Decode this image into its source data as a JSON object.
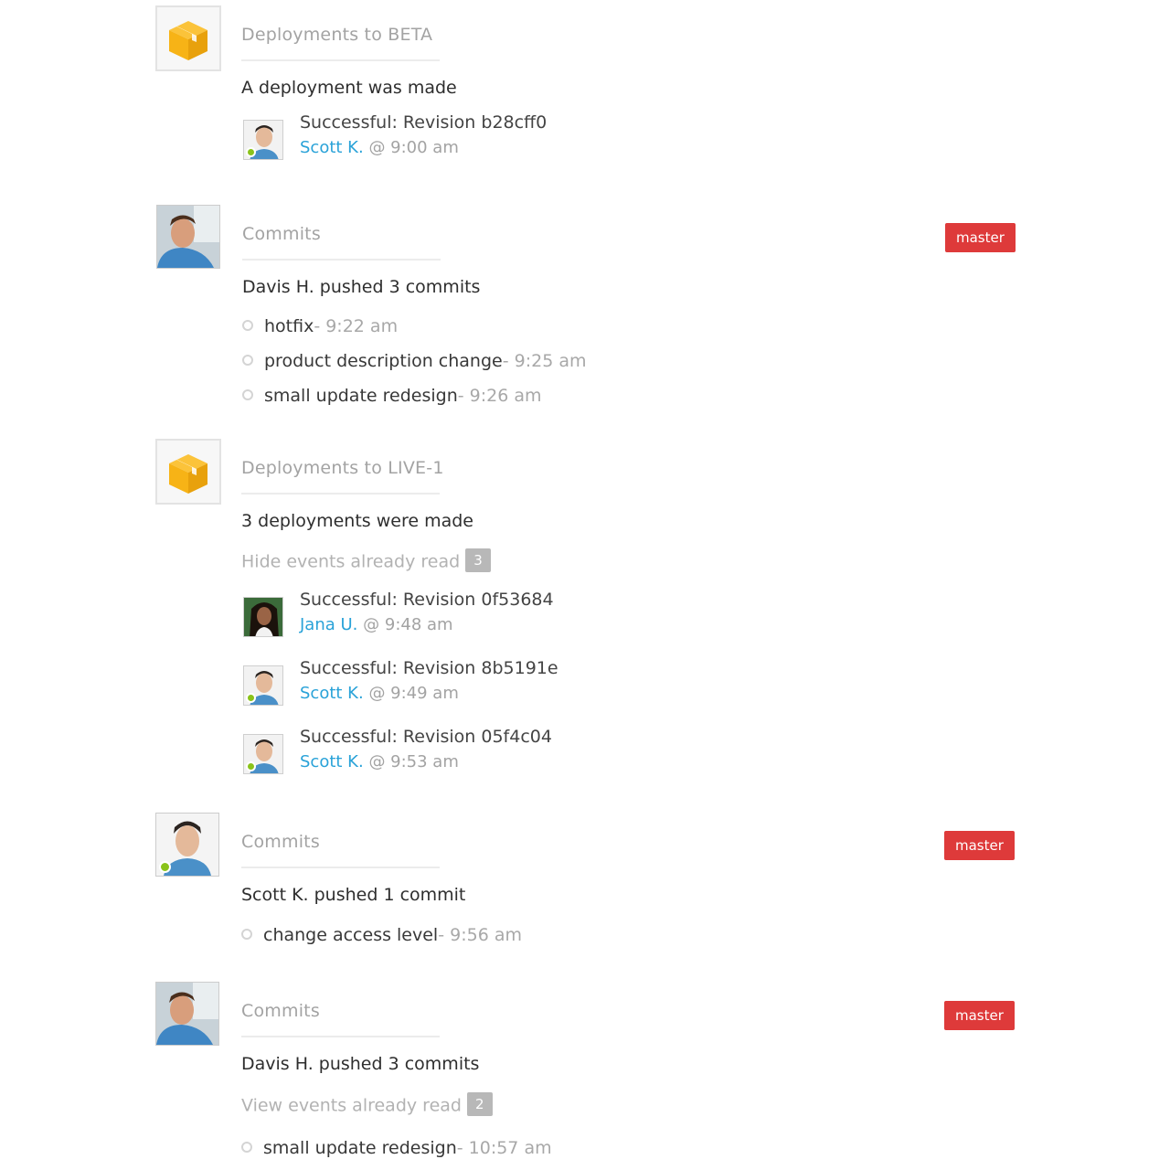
{
  "colors": {
    "accent": "#29a2d8",
    "badge": "#de3a3a",
    "online": "#8ac31a",
    "box_icon": "#f7b316"
  },
  "events": [
    {
      "title": "Deployments to BETA",
      "summary": "A deployment was made",
      "deployments": [
        {
          "revision": "Successful: Revision b28cff0",
          "user": "Scott K.",
          "at": "@ 9:00 am"
        }
      ]
    },
    {
      "title": "Commits",
      "badge": "master",
      "summary": "Davis H. pushed 3 commits",
      "commits": [
        {
          "message": "hotfix",
          "time": "- 9:22 am"
        },
        {
          "message": "product description change",
          "time": "- 9:25 am"
        },
        {
          "message": "small update redesign",
          "time": "- 9:26 am"
        }
      ]
    },
    {
      "title": "Deployments to LIVE-1",
      "summary": "3 deployments were made",
      "toggle": {
        "label": "Hide events already read",
        "count": "3"
      },
      "deployments": [
        {
          "revision": "Successful: Revision 0f53684",
          "user": "Jana U.",
          "at": "@ 9:48 am"
        },
        {
          "revision": "Successful: Revision 8b5191e",
          "user": "Scott K.",
          "at": "@ 9:49 am"
        },
        {
          "revision": "Successful: Revision 05f4c04",
          "user": "Scott K.",
          "at": "@ 9:53 am"
        }
      ]
    },
    {
      "title": "Commits",
      "badge": "master",
      "summary": "Scott K. pushed 1 commit",
      "commits": [
        {
          "message": "change access level",
          "time": "- 9:56 am"
        }
      ]
    },
    {
      "title": "Commits",
      "badge": "master",
      "summary": "Davis H. pushed 3 commits",
      "toggle": {
        "label": "View events already read",
        "count": "2"
      },
      "commits": [
        {
          "message": "small update redesign",
          "time": "- 10:57 am"
        }
      ]
    }
  ]
}
